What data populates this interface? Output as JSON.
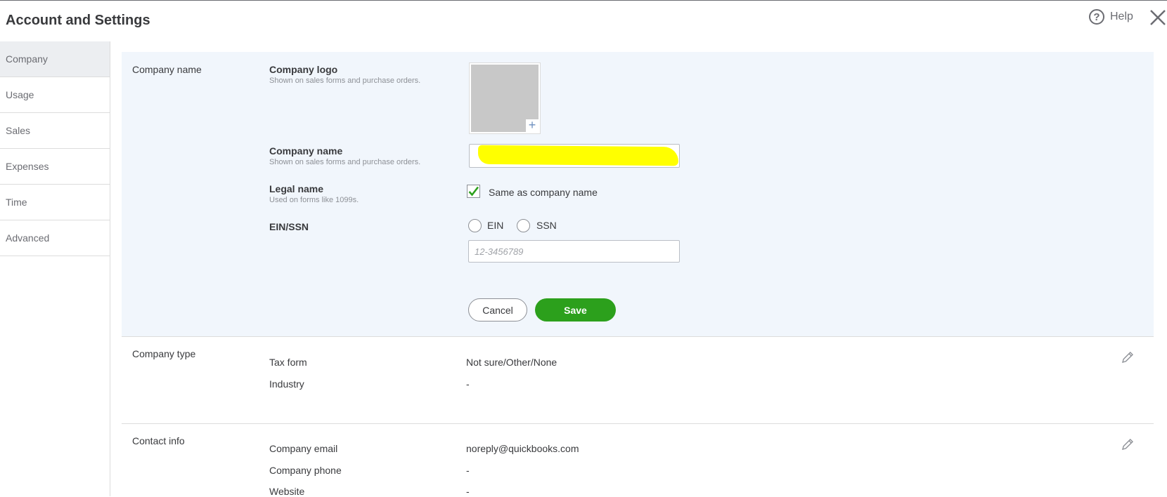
{
  "header": {
    "title": "Account and Settings",
    "help_label": "Help"
  },
  "sidebar": {
    "items": [
      {
        "label": "Company",
        "active": true
      },
      {
        "label": "Usage"
      },
      {
        "label": "Sales"
      },
      {
        "label": "Expenses"
      },
      {
        "label": "Time"
      },
      {
        "label": "Advanced"
      }
    ]
  },
  "company_name_section": {
    "label": "Company name",
    "logo": {
      "title": "Company logo",
      "subtitle": "Shown on sales forms and purchase orders."
    },
    "name": {
      "title": "Company name",
      "subtitle": "Shown on sales forms and purchase orders.",
      "value": ""
    },
    "legal": {
      "title": "Legal name",
      "subtitle": "Used on forms like 1099s.",
      "checkbox_label": "Same as company name",
      "checked": true
    },
    "ein_ssn": {
      "title": "EIN/SSN",
      "option_ein": "EIN",
      "option_ssn": "SSN",
      "placeholder": "12-3456789"
    },
    "cancel_label": "Cancel",
    "save_label": "Save"
  },
  "company_type_section": {
    "label": "Company type",
    "rows": [
      {
        "label": "Tax form",
        "value": "Not sure/Other/None"
      },
      {
        "label": "Industry",
        "value": "-"
      }
    ]
  },
  "contact_section": {
    "label": "Contact info",
    "rows": [
      {
        "label": "Company email",
        "value": "noreply@quickbooks.com"
      },
      {
        "label": "Company phone",
        "value": "-"
      },
      {
        "label": "Website",
        "value": "-"
      }
    ]
  },
  "colors": {
    "accent_green": "#2ca01c",
    "panel_background": "#f1f6fc",
    "redaction": "#ffff00"
  },
  "icons": [
    "help-icon",
    "close-icon",
    "plus-icon",
    "check-icon",
    "pencil-icon"
  ]
}
